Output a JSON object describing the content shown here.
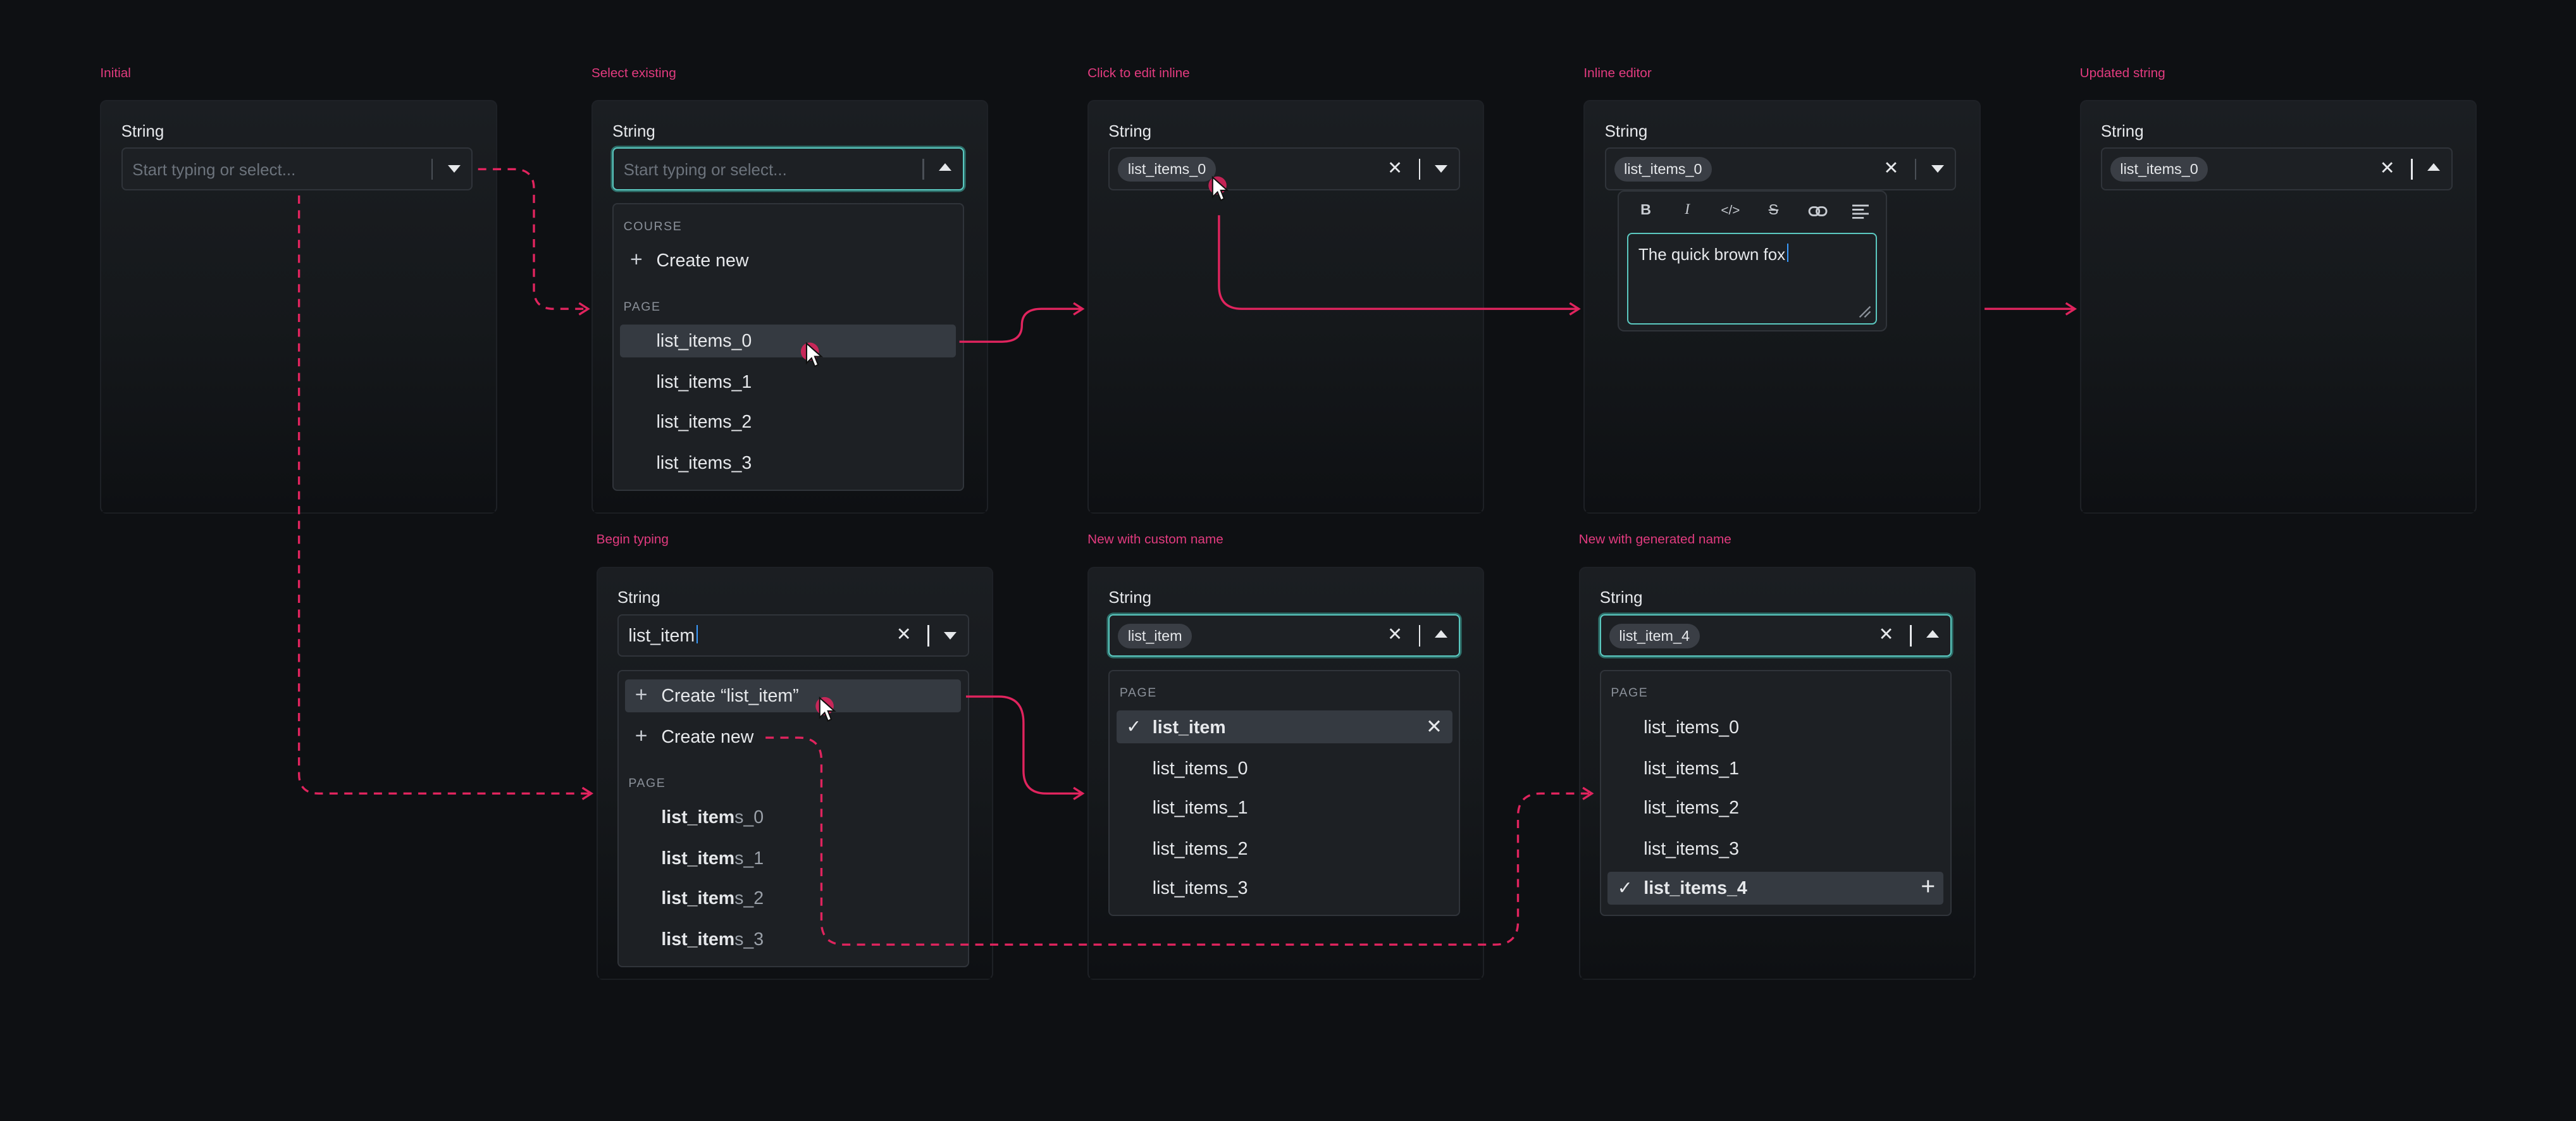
{
  "captions": {
    "initial": "Initial",
    "select_existing": "Select existing",
    "click_to_edit": "Click to edit inline",
    "inline_editor": "Inline editor",
    "updated_string": "Updated string",
    "begin_typing": "Begin typing",
    "new_custom": "New with custom name",
    "new_generated": "New with generated name"
  },
  "field_label": "String",
  "placeholder": "Start typing or select...",
  "chip_value": "list_items_0",
  "section_course": "COURSE",
  "section_page": "PAGE",
  "create_new": "Create new",
  "create_typed": "Create “list_item”",
  "typed_text": "list_item",
  "existing_items": [
    "list_items_0",
    "list_items_1",
    "list_items_2",
    "list_items_3"
  ],
  "typed_match": {
    "prefix": "list_item",
    "suffixes": [
      "s_0",
      "s_1",
      "s_2",
      "s_3"
    ]
  },
  "custom_chip": "list_item",
  "custom_selected": "list_item",
  "generated_chip": "list_item_4",
  "generated_selected": "list_items_4",
  "editor_text": "The quick brown fox",
  "toolbar_glyphs": {
    "bold": "B",
    "italic": "I",
    "code": "</>",
    "strike": "S"
  },
  "colors": {
    "accent_flow": "#e0245e",
    "focus_ring": "#5bc8c0",
    "caret": "#3a9bff",
    "background": "#0e1013"
  }
}
